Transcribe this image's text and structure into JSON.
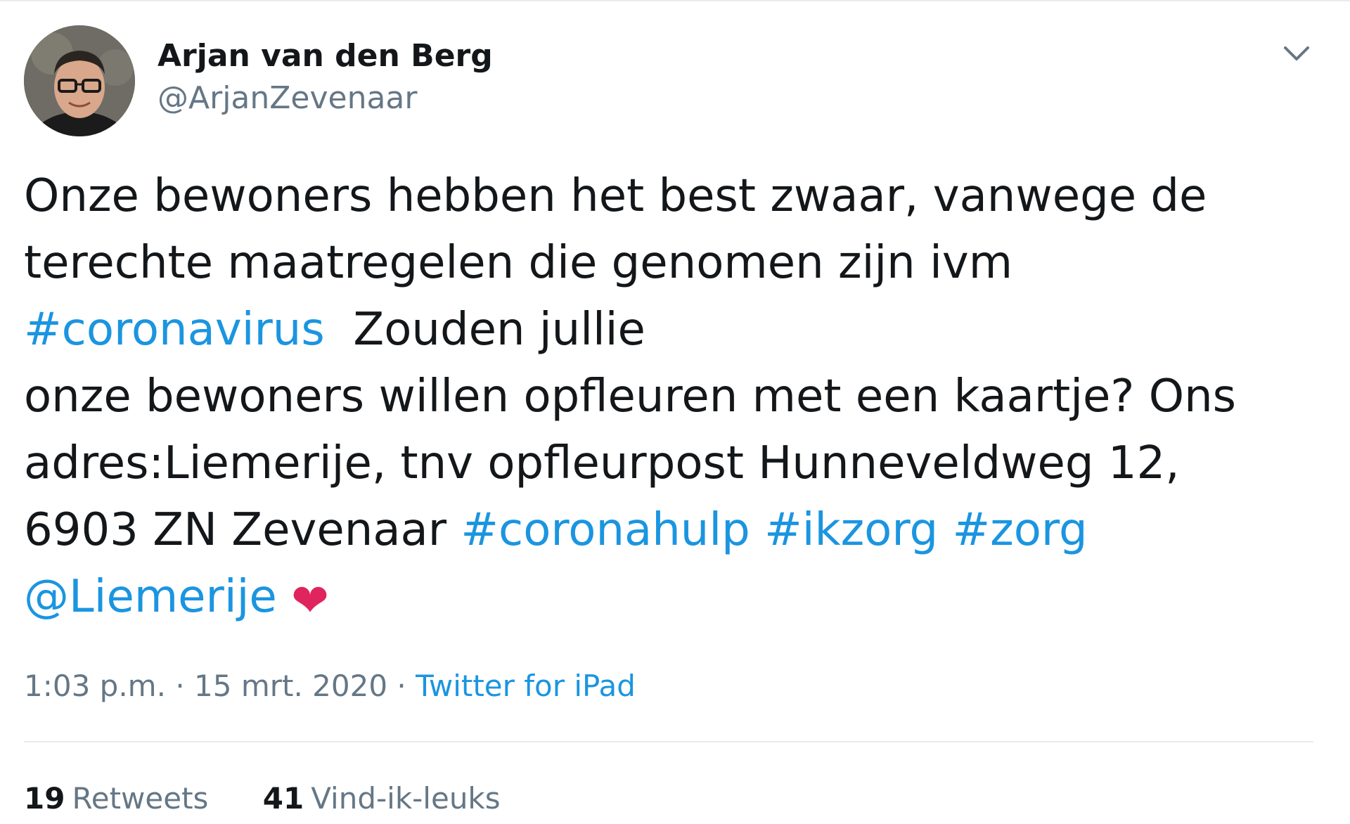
{
  "author": {
    "display_name": "Arjan van den Berg",
    "handle": "@ArjanZevenaar"
  },
  "tweet": {
    "lines": [
      [
        {
          "text": "Onze bewoners hebben het best zwaar, vanwege de",
          "type": "text"
        }
      ],
      [
        {
          "text": "terechte maatregelen die genomen zijn ivm",
          "type": "text"
        }
      ],
      [
        {
          "text": "#coronavirus",
          "type": "hashtag"
        },
        {
          "text": "  Zouden jullie",
          "type": "text"
        }
      ],
      [
        {
          "text": "onze bewoners willen opfleuren met een kaartje? Ons",
          "type": "text"
        }
      ],
      [
        {
          "text": "adres:Liemerije, tnv opfleurpost Hunneveldweg 12,",
          "type": "text"
        }
      ],
      [
        {
          "text": "6903 ZN Zevenaar ",
          "type": "text"
        },
        {
          "text": "#coronahulp",
          "type": "hashtag"
        },
        {
          "text": " ",
          "type": "text"
        },
        {
          "text": "#ikzorg",
          "type": "hashtag"
        },
        {
          "text": " ",
          "type": "text"
        },
        {
          "text": "#zorg",
          "type": "hashtag"
        }
      ],
      [
        {
          "text": "@Liemerije",
          "type": "mention"
        },
        {
          "text": " ",
          "type": "text"
        },
        {
          "text": "❤",
          "type": "emoji"
        }
      ]
    ]
  },
  "meta": {
    "time": "1:03 p.m.",
    "separator": "·",
    "date": "15 mrt. 2020",
    "source": "Twitter for iPad"
  },
  "stats": {
    "retweets_count": "19",
    "retweets_label": "Retweets",
    "likes_count": "41",
    "likes_label": "Vind-ik-leuks"
  },
  "icons": {
    "caret": "chevron-down-icon",
    "emoji": "red-heart-icon"
  },
  "colors": {
    "link": "#1b95e0",
    "text": "#14171a",
    "secondary": "#657786",
    "heart": "#e0245e",
    "divider": "#e6ecf0"
  }
}
